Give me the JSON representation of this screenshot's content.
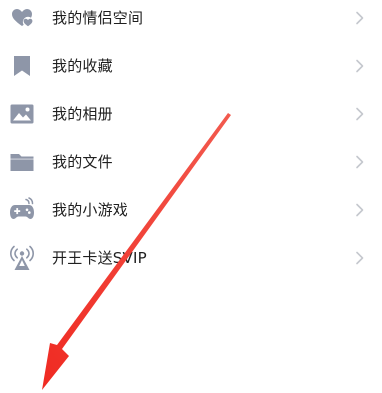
{
  "menu": {
    "items": [
      {
        "label": "我的情侣空间",
        "icon": "couple-heart-icon"
      },
      {
        "label": "我的收藏",
        "icon": "bookmark-icon"
      },
      {
        "label": "我的相册",
        "icon": "photo-album-icon"
      },
      {
        "label": "我的文件",
        "icon": "folder-icon"
      },
      {
        "label": "我的小游戏",
        "icon": "gamepad-icon"
      },
      {
        "label": "开王卡送SVIP",
        "icon": "signal-tower-icon"
      }
    ]
  },
  "colors": {
    "icon": "#8e96a8",
    "chevron": "#c5c8ce",
    "text": "#1f1f1f",
    "arrow": "#f23a2f"
  }
}
